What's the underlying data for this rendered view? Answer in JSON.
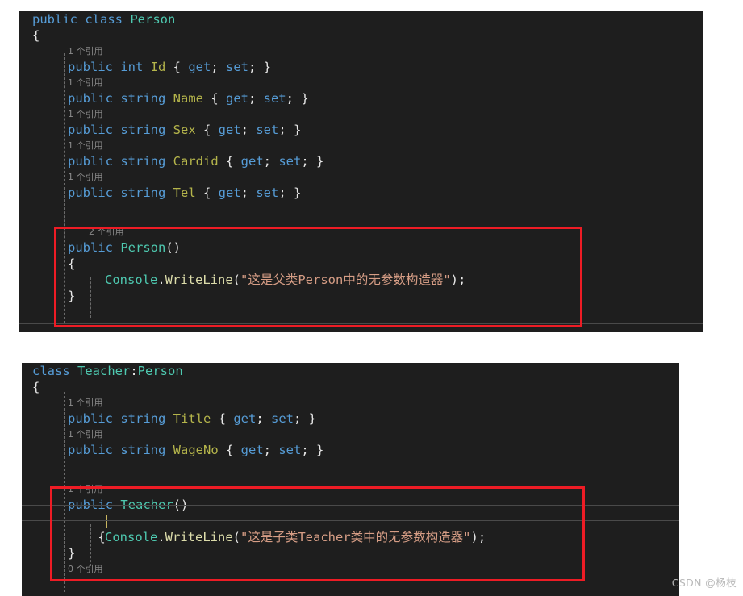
{
  "page": {
    "background_color": "#ffffff",
    "editor_background": "#1e1e1e",
    "annotation_color": "#ee1c25"
  },
  "watermark": {
    "text": "CSDN @杨枝"
  },
  "blocks": {
    "person": {
      "lines": {
        "l01": {
          "kw": "public class ",
          "type": "Person"
        },
        "l02": {
          "punc": "{"
        },
        "l03": {
          "ref": "1 个引用"
        },
        "l04": {
          "kw1": "public ",
          "kw2": "int ",
          "prop": "Id ",
          "open": "{ ",
          "get": "get",
          "s1": "; ",
          "set": "set",
          "s2": "; ",
          "close": "}"
        },
        "l05": {
          "ref": "1 个引用"
        },
        "l06": {
          "kw1": "public ",
          "kw2": "string ",
          "prop": "Name ",
          "open": "{ ",
          "get": "get",
          "s1": "; ",
          "set": "set",
          "s2": "; ",
          "close": "}"
        },
        "l07": {
          "ref": "1 个引用"
        },
        "l08": {
          "kw1": "public ",
          "kw2": "string ",
          "prop": "Sex ",
          "open": "{ ",
          "get": "get",
          "s1": "; ",
          "set": "set",
          "s2": "; ",
          "close": "}"
        },
        "l09": {
          "ref": "1 个引用"
        },
        "l10": {
          "kw1": "public ",
          "kw2": "string ",
          "prop": "Cardid ",
          "open": "{ ",
          "get": "get",
          "s1": "; ",
          "set": "set",
          "s2": "; ",
          "close": "}"
        },
        "l11": {
          "ref": "1 个引用"
        },
        "l12": {
          "kw1": "public ",
          "kw2": "string ",
          "prop": "Tel ",
          "open": "{ ",
          "get": "get",
          "s1": "; ",
          "set": "set",
          "s2": "; ",
          "close": "}"
        },
        "l13": {
          "ref": "2 个引用"
        },
        "l14": {
          "kw": "public ",
          "type": "Person",
          "punc": "()"
        },
        "l15": {
          "punc": "{"
        },
        "l16": {
          "cls": "Console",
          "dot": ".",
          "method": "WriteLine",
          "open": "(",
          "str": "\"这是父类Person中的无参数构造器\"",
          "close": ");"
        },
        "l17": {
          "punc": "}"
        }
      }
    },
    "teacher": {
      "lines": {
        "l01": {
          "kw": "class ",
          "type": "Teacher",
          "colon": ":",
          "base": "Person"
        },
        "l02": {
          "punc": "{"
        },
        "l03": {
          "ref": "1 个引用"
        },
        "l04": {
          "kw1": "public ",
          "kw2": "string ",
          "prop": "Title ",
          "open": "{ ",
          "get": "get",
          "s1": "; ",
          "set": "set",
          "s2": "; ",
          "close": "}"
        },
        "l05": {
          "ref": "1 个引用"
        },
        "l06": {
          "kw1": "public ",
          "kw2": "string ",
          "prop": "WageNo ",
          "open": "{ ",
          "get": "get",
          "s1": "; ",
          "set": "set",
          "s2": "; ",
          "close": "}"
        },
        "l07": {
          "ref": "1 个引用"
        },
        "l08": {
          "kw": "public ",
          "type": "Teacher",
          "punc": "()"
        },
        "l09": {
          "punc": "{"
        },
        "l10": {
          "cls": "Console",
          "dot": ".",
          "method": "WriteLine",
          "open": "(",
          "str": "\"这是子类Teacher类中的无参数构造器\"",
          "close": ");"
        },
        "l11": {
          "punc": "}"
        },
        "l12": {
          "ref": "0 个引用"
        }
      }
    }
  }
}
